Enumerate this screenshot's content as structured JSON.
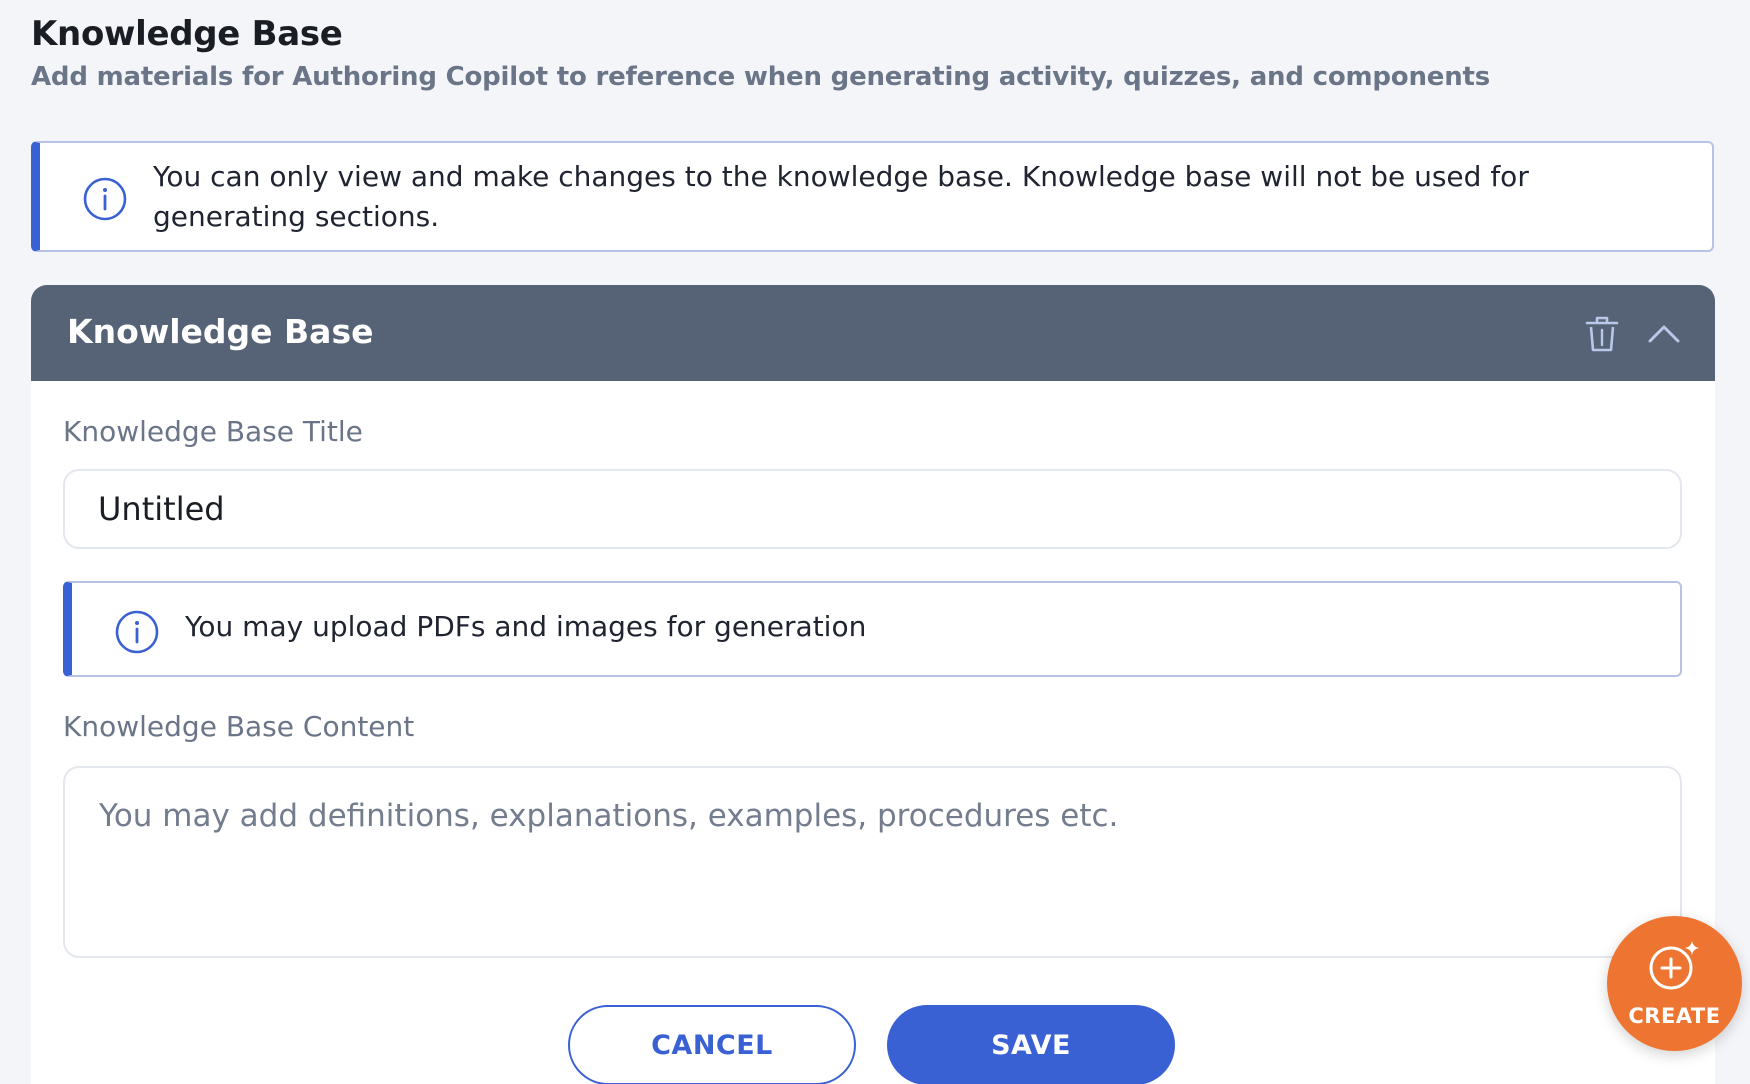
{
  "header": {
    "title": "Knowledge Base",
    "subtitle": "Add materials for Authoring Copilot to reference when generating activity, quizzes, and components"
  },
  "notice": {
    "icon": "info-icon",
    "text": "You can only view and make changes to the knowledge base. Knowledge base will not be used for generating sections."
  },
  "card": {
    "title": "Knowledge Base",
    "actions": [
      "trash-icon",
      "chevron-up-icon"
    ],
    "title_field": {
      "label": "Knowledge Base Title",
      "value": "Untitled"
    },
    "upload_notice": {
      "icon": "info-icon",
      "text": "You may upload PDFs and images for generation"
    },
    "content_field": {
      "label": "Knowledge Base Content",
      "value": "",
      "placeholder": "You may add definitions, explanations, examples, procedures etc."
    },
    "buttons": {
      "cancel": "CANCEL",
      "save": "SAVE"
    }
  },
  "fab": {
    "icon": "plus-sparkle-icon",
    "label": "CREATE"
  },
  "colors": {
    "accent": "#3a61d4",
    "card_header": "#566275",
    "fab": "#ee7531",
    "background": "#f3f5f9",
    "notice_border": "#b7c2e8"
  }
}
